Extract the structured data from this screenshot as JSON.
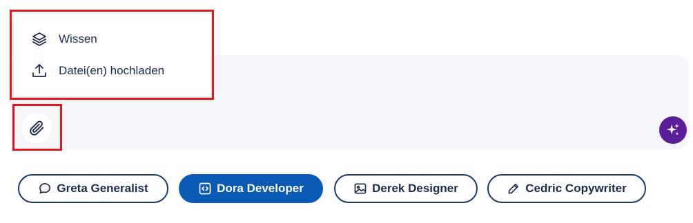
{
  "menu": {
    "items": [
      {
        "label": "Wissen",
        "icon": "layers-icon"
      },
      {
        "label": "Datei(en) hochladen",
        "icon": "upload-icon"
      }
    ]
  },
  "composer": {
    "attach_icon": "paperclip-icon",
    "sparkle_icon": "sparkle-icon"
  },
  "personas": [
    {
      "label": "Greta Generalist",
      "icon": "chat-bubble-icon",
      "active": false
    },
    {
      "label": "Dora Developer",
      "icon": "code-icon",
      "active": true
    },
    {
      "label": "Derek Designer",
      "icon": "image-icon",
      "active": false
    },
    {
      "label": "Cedric Copywriter",
      "icon": "pencil-icon",
      "active": false
    }
  ],
  "colors": {
    "accent": "#0b5bb5",
    "chip_border": "#1f3868",
    "sparkle_bg": "#5b1e9a",
    "highlight": "#e3161e",
    "composer_bg": "#f4f6fa"
  }
}
